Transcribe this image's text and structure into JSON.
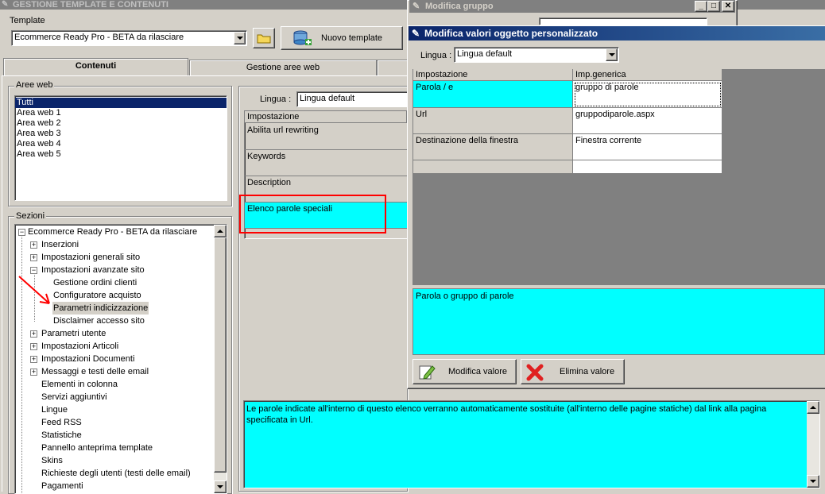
{
  "app": {
    "title": "GESTIONE TEMPLATE E CONTENUTI"
  },
  "template_group": {
    "label": "Template",
    "selected": "Ecommerce Ready Pro - BETA da rilasciare",
    "new_button": "Nuovo template"
  },
  "tabs": [
    {
      "label": "Contenuti"
    },
    {
      "label": "Gestione aree web"
    }
  ],
  "aree_web": {
    "label": "Aree web",
    "items": [
      "Tutti",
      "Area web 1",
      "Area web 2",
      "Area web 3",
      "Area web 4",
      "Area web 5"
    ]
  },
  "sezioni": {
    "label": "Sezioni",
    "tree": [
      {
        "label": "Ecommerce Ready Pro - BETA da rilasciare",
        "box": "−"
      },
      {
        "label": "Inserzioni",
        "box": "+"
      },
      {
        "label": "Impostazioni generali sito",
        "box": "+"
      },
      {
        "label": "Impostazioni avanzate sito",
        "box": "−"
      },
      {
        "label": "Gestione ordini clienti"
      },
      {
        "label": "Configuratore acquisto"
      },
      {
        "label": "Parametri indicizzazione"
      },
      {
        "label": "Disclaimer accesso sito"
      },
      {
        "label": "Parametri utente",
        "box": "+"
      },
      {
        "label": "Impostazioni Articoli",
        "box": "+"
      },
      {
        "label": "Impostazioni Documenti",
        "box": "+"
      },
      {
        "label": "Messaggi e testi delle email",
        "box": "+"
      },
      {
        "label": "Elementi in colonna"
      },
      {
        "label": "Servizi aggiuntivi"
      },
      {
        "label": "Lingue"
      },
      {
        "label": "Feed RSS"
      },
      {
        "label": "Statistiche"
      },
      {
        "label": "Pannello anteprima template"
      },
      {
        "label": "Skins"
      },
      {
        "label": "Richieste degli utenti (testi delle email)"
      },
      {
        "label": "Pagamenti"
      }
    ]
  },
  "content_panel": {
    "lingua_label": "Lingua :",
    "lingua_value": "Lingua default",
    "grid_header": "Impostazione",
    "rows": [
      "Abilita url rewriting",
      "Keywords",
      "Description",
      "Elenco parole speciali"
    ],
    "description": "Le parole indicate all'interno di questo elenco verranno automaticamente sostituite (all'interno delle pagine statiche) dal link alla pagina specificata in Url."
  },
  "modifica_gruppo": {
    "title": "Modifica gruppo"
  },
  "modifica_valori": {
    "title": "Modifica valori oggetto personalizzato",
    "lingua_label": "Lingua :",
    "lingua_value": "Lingua default",
    "col_impostazione": "Impostazione",
    "col_imp_generica": "Imp.generica",
    "rows": [
      {
        "name": "Parola / e",
        "value": "gruppo di parole"
      },
      {
        "name": "Url",
        "value": "gruppodiparole.aspx"
      },
      {
        "name": "Destinazione della finestra",
        "value": "Finestra corrente"
      }
    ],
    "description": "Parola o gruppo di parole",
    "edit_button": "Modifica valore",
    "delete_button": "Elimina valore"
  },
  "colors": {
    "highlight": "#00ffff",
    "selection": "#0a246a",
    "annotation": "#ff0000"
  }
}
